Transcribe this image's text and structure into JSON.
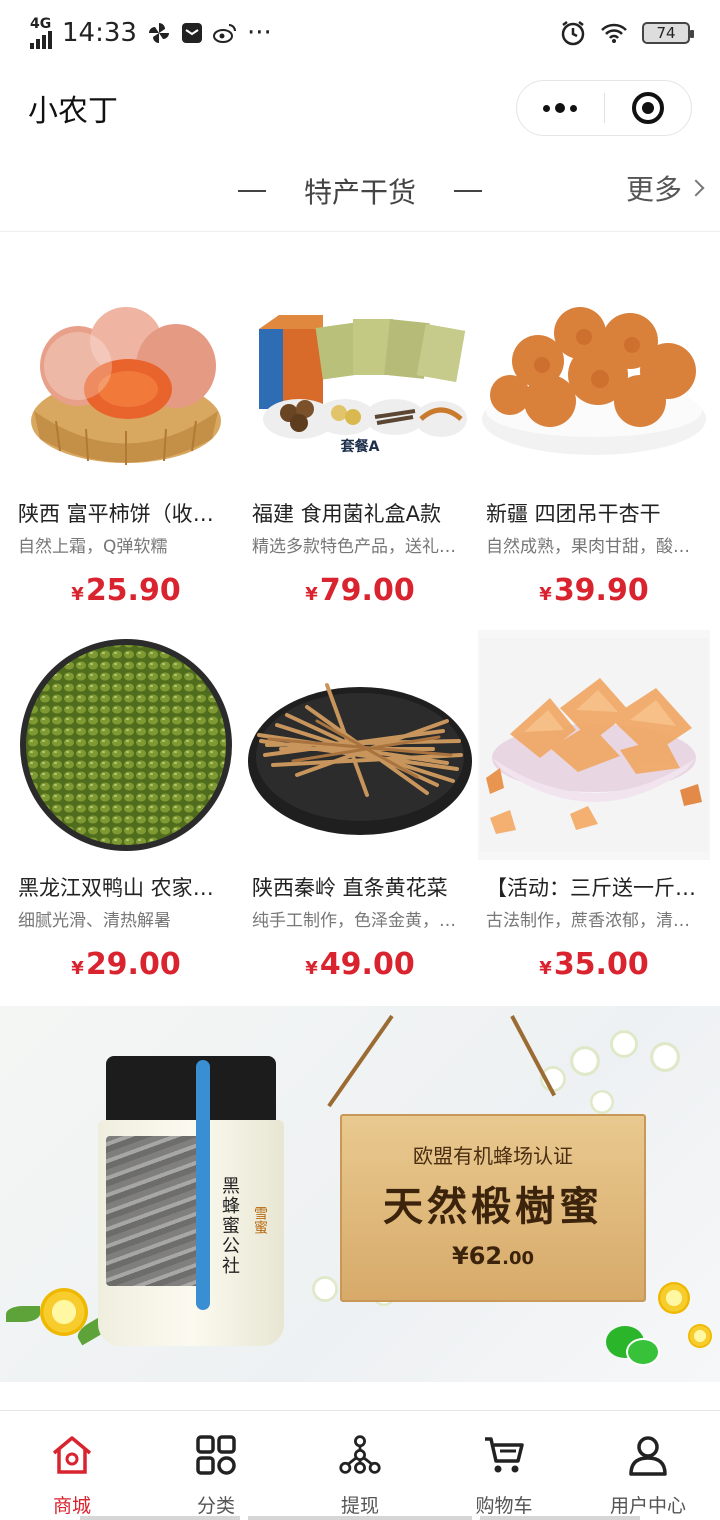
{
  "status_bar": {
    "network": "4G",
    "time": "14:33",
    "notifications": [
      "pinwheel-icon",
      "mail-icon",
      "weibo-icon"
    ],
    "more": "···",
    "battery": "74"
  },
  "header": {
    "title": "小农丁"
  },
  "section": {
    "title": "特产干货",
    "more": "更多"
  },
  "products": [
    {
      "title": "陕西 富平柿饼（收藏加购优先发货）",
      "desc": "自然上霜，Q弹软糯",
      "currency": "¥",
      "price": "25.90",
      "image": "dried-persimmon-basket"
    },
    {
      "title": "福建 食用菌礼盒A款",
      "desc": "精选多款特色产品，送礼佳品",
      "currency": "¥",
      "price": "79.00",
      "image": "mushroom-gift-box",
      "image_caption": "套餐A"
    },
    {
      "title": "新疆 四团吊干杏干",
      "desc": "自然成熟，果肉甘甜，酸甜可口",
      "currency": "¥",
      "price": "39.90",
      "image": "dried-apricots-bowl"
    },
    {
      "title": "黑龙江双鸭山 农家绿豆",
      "desc": "细腻光滑、清热解暑",
      "currency": "¥",
      "price": "29.00",
      "image": "mung-beans-plate"
    },
    {
      "title": "陕西秦岭 直条黄花菜",
      "desc": "纯手工制作，色泽金黄，口感爽滑",
      "currency": "¥",
      "price": "49.00",
      "image": "daylily-plate"
    },
    {
      "title": "【活动：三斤送一斤】老冰糖",
      "desc": "古法制作，蔗香浓郁，清甜润口",
      "currency": "¥",
      "price": "35.00",
      "image": "rock-sugar-bowl"
    }
  ],
  "banner": {
    "subtitle": "欧盟有机蜂场认证",
    "headline": "天然椴樹蜜",
    "currency": "¥",
    "price_int": "62",
    "price_dec": ".00",
    "jar_text": "黑蜂蜜公社",
    "jar_tag": "雪蜜"
  },
  "tab_bar": {
    "tabs": [
      {
        "label": "商城",
        "icon": "home-icon",
        "active": true
      },
      {
        "label": "分类",
        "icon": "category-grid-icon",
        "active": false
      },
      {
        "label": "提现",
        "icon": "withdraw-network-icon",
        "active": false
      },
      {
        "label": "购物车",
        "icon": "cart-icon",
        "active": false
      },
      {
        "label": "用户中心",
        "icon": "user-icon",
        "active": false
      }
    ]
  },
  "colors": {
    "accent": "#d9242f",
    "text": "#222222",
    "muted": "#777777"
  }
}
